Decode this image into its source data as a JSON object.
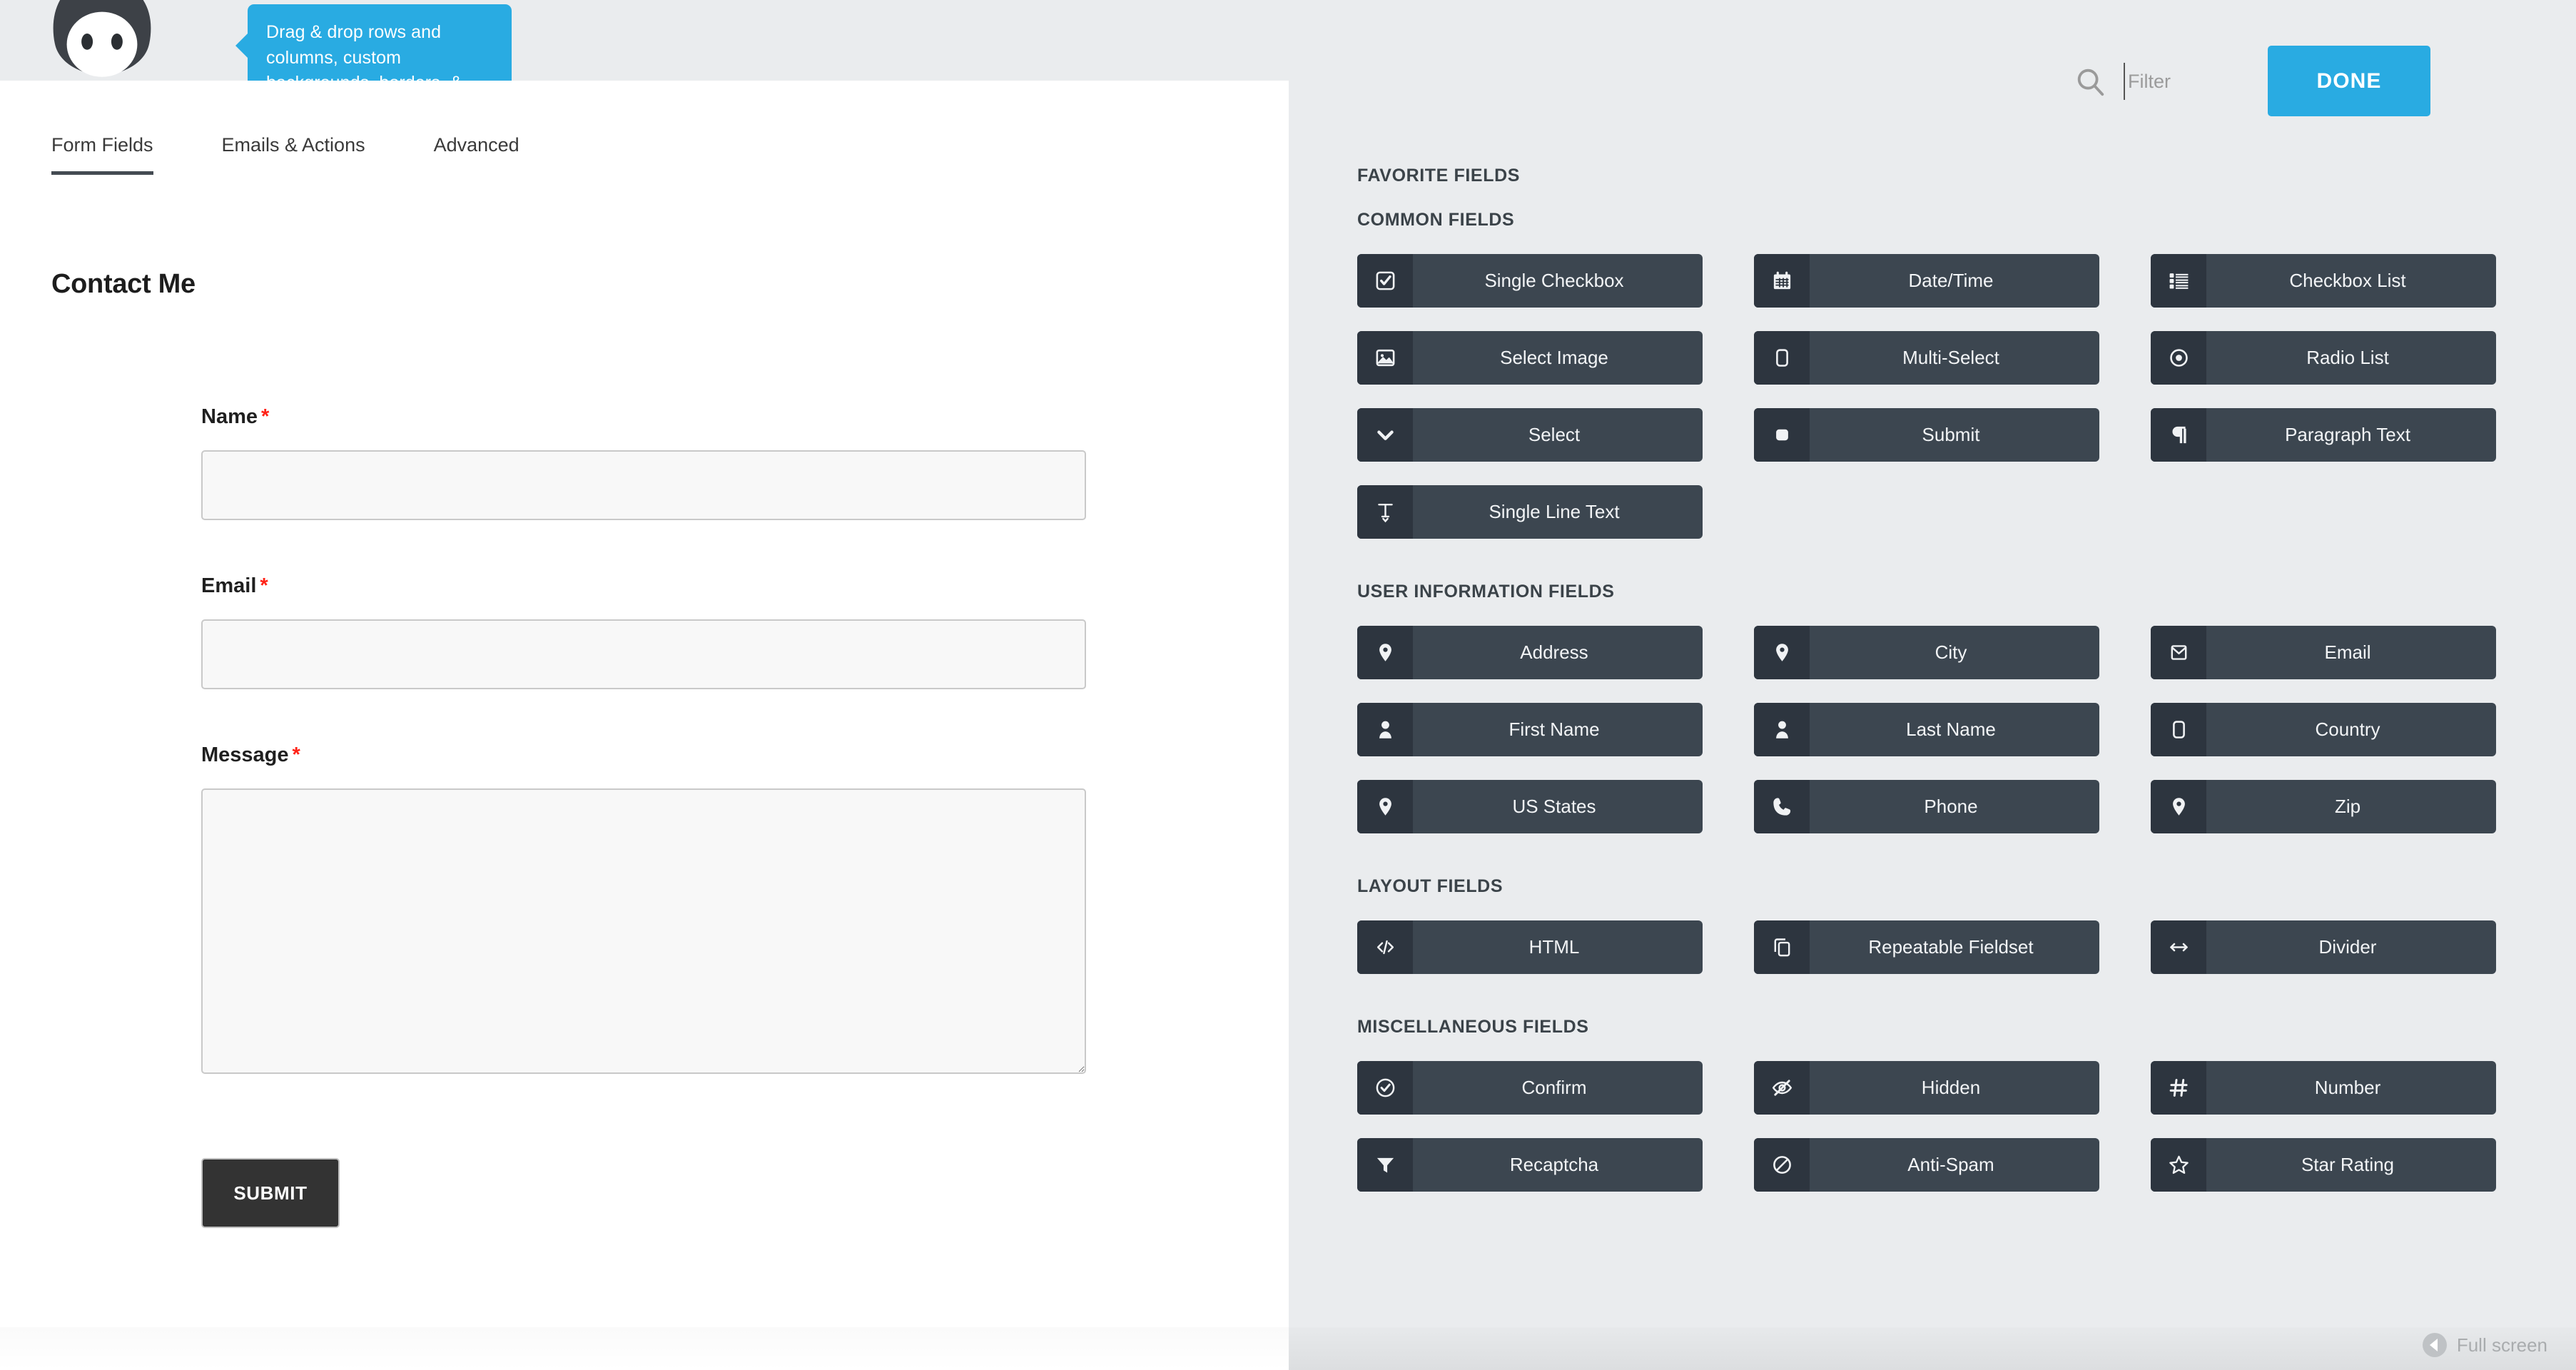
{
  "tooltip": {
    "text": "Drag & drop rows and columns, custom backgrounds, borders, & more without writing a single line of code."
  },
  "logo": {
    "icon": "ninja-mascot-logo"
  },
  "builder": {
    "tabs": [
      {
        "label": "Form Fields",
        "active": true
      },
      {
        "label": "Emails & Actions",
        "active": false
      },
      {
        "label": "Advanced",
        "active": false
      }
    ],
    "title": "Contact Me",
    "fields": [
      {
        "label": "Name",
        "required": "*",
        "type": "text",
        "value": "",
        "placeholder": ""
      },
      {
        "label": "Email",
        "required": "*",
        "type": "text",
        "value": "",
        "placeholder": ""
      },
      {
        "label": "Message",
        "required": "*",
        "type": "textarea",
        "value": "",
        "placeholder": ""
      }
    ],
    "submit_label": "SUBMIT"
  },
  "picker": {
    "search": {
      "placeholder": "Filter",
      "value": "",
      "icon": "search-icon"
    },
    "done_label": "DONE",
    "sections": [
      {
        "title": "FAVORITE FIELDS",
        "items": []
      },
      {
        "title": "COMMON FIELDS",
        "items": [
          {
            "label": "Single Checkbox",
            "icon": "checkbox-checked-icon"
          },
          {
            "label": "Date/Time",
            "icon": "calendar-icon"
          },
          {
            "label": "Checkbox List",
            "icon": "list-icon"
          },
          {
            "label": "Select Image",
            "icon": "image-icon"
          },
          {
            "label": "Multi-Select",
            "icon": "rounded-square-icon"
          },
          {
            "label": "Radio List",
            "icon": "radio-button-icon"
          },
          {
            "label": "Select",
            "icon": "chevron-down-icon"
          },
          {
            "label": "Submit",
            "icon": "filled-rounded-square-icon"
          },
          {
            "label": "Paragraph Text",
            "icon": "pilcrow-icon"
          },
          {
            "label": "Single Line Text",
            "icon": "text-cursor-icon"
          }
        ]
      },
      {
        "title": "USER INFORMATION FIELDS",
        "items": [
          {
            "label": "Address",
            "icon": "map-pin-icon"
          },
          {
            "label": "City",
            "icon": "map-pin-icon"
          },
          {
            "label": "Email",
            "icon": "envelope-icon"
          },
          {
            "label": "First Name",
            "icon": "user-icon"
          },
          {
            "label": "Last Name",
            "icon": "user-icon"
          },
          {
            "label": "Country",
            "icon": "rounded-square-icon"
          },
          {
            "label": "US States",
            "icon": "map-pin-icon"
          },
          {
            "label": "Phone",
            "icon": "phone-icon"
          },
          {
            "label": "Zip",
            "icon": "map-pin-icon"
          }
        ]
      },
      {
        "title": "LAYOUT FIELDS",
        "items": [
          {
            "label": "HTML",
            "icon": "code-icon"
          },
          {
            "label": "Repeatable Fieldset",
            "icon": "copy-icon"
          },
          {
            "label": "Divider",
            "icon": "arrows-horizontal-icon"
          }
        ]
      },
      {
        "title": "MISCELLANEOUS FIELDS",
        "items": [
          {
            "label": "Confirm",
            "icon": "check-circle-icon"
          },
          {
            "label": "Hidden",
            "icon": "eye-slash-icon"
          },
          {
            "label": "Number",
            "icon": "hash-icon"
          },
          {
            "label": "Recaptcha",
            "icon": "funnel-icon"
          },
          {
            "label": "Anti-Spam",
            "icon": "ban-icon"
          },
          {
            "label": "Star Rating",
            "icon": "star-icon"
          }
        ]
      }
    ]
  },
  "statusbar": {
    "fullscreen_label": "Full screen",
    "fullscreen_icon": "play-left-circle-icon"
  },
  "colors": {
    "accent": "#29abe2",
    "field_btn_bg": "#3c4650",
    "field_btn_icon_bg": "#2d353f",
    "panel_bg": "#eaecee",
    "required": "#ff2116",
    "submit_bg": "#333333"
  }
}
